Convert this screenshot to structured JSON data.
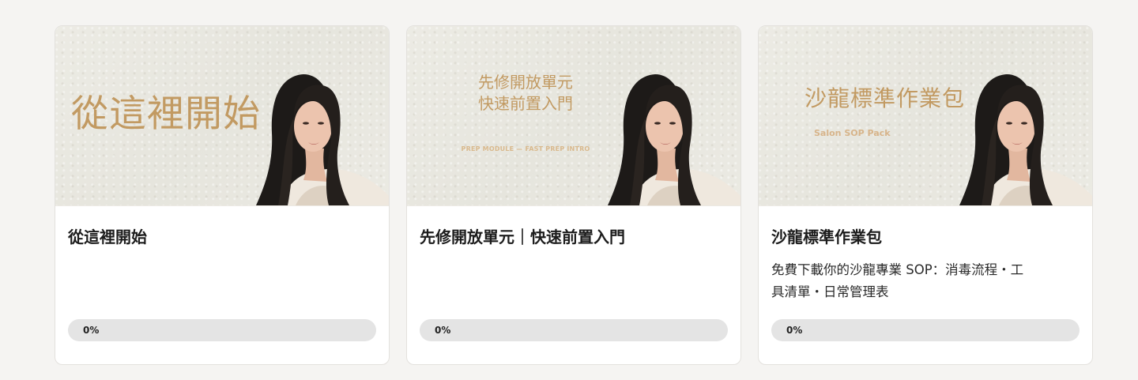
{
  "courses": [
    {
      "banner": {
        "title": "從這裡開始"
      },
      "title": "從這裡開始",
      "description": "",
      "progress": {
        "label": "0%",
        "fraction": 0
      }
    },
    {
      "banner": {
        "title_line1": "先修開放單元",
        "title_line2": "快速前置入門",
        "subtitle": "PREP MODULE — FAST PREP INTRO"
      },
      "title": "先修開放單元｜快速前置入門",
      "description": "",
      "progress": {
        "label": "0%",
        "fraction": 0
      }
    },
    {
      "banner": {
        "title": "沙龍標準作業包",
        "subtitle": "Salon SOP Pack"
      },
      "title": "沙龍標準作業包",
      "description_line1": "免費下載你的沙龍專業 SOP：消毒流程・工",
      "description_line2": "具清單・日常管理表",
      "progress": {
        "label": "0%",
        "fraction": 0
      }
    }
  ]
}
